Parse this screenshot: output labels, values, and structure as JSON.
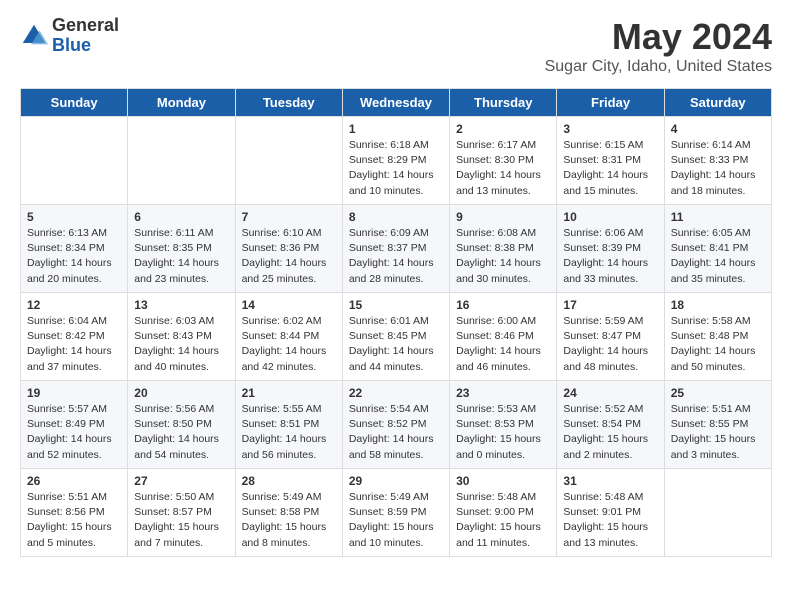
{
  "logo": {
    "general": "General",
    "blue": "Blue"
  },
  "title": "May 2024",
  "subtitle": "Sugar City, Idaho, United States",
  "days_of_week": [
    "Sunday",
    "Monday",
    "Tuesday",
    "Wednesday",
    "Thursday",
    "Friday",
    "Saturday"
  ],
  "weeks": [
    [
      {
        "day": "",
        "info": ""
      },
      {
        "day": "",
        "info": ""
      },
      {
        "day": "",
        "info": ""
      },
      {
        "day": "1",
        "info": "Sunrise: 6:18 AM\nSunset: 8:29 PM\nDaylight: 14 hours\nand 10 minutes."
      },
      {
        "day": "2",
        "info": "Sunrise: 6:17 AM\nSunset: 8:30 PM\nDaylight: 14 hours\nand 13 minutes."
      },
      {
        "day": "3",
        "info": "Sunrise: 6:15 AM\nSunset: 8:31 PM\nDaylight: 14 hours\nand 15 minutes."
      },
      {
        "day": "4",
        "info": "Sunrise: 6:14 AM\nSunset: 8:33 PM\nDaylight: 14 hours\nand 18 minutes."
      }
    ],
    [
      {
        "day": "5",
        "info": "Sunrise: 6:13 AM\nSunset: 8:34 PM\nDaylight: 14 hours\nand 20 minutes."
      },
      {
        "day": "6",
        "info": "Sunrise: 6:11 AM\nSunset: 8:35 PM\nDaylight: 14 hours\nand 23 minutes."
      },
      {
        "day": "7",
        "info": "Sunrise: 6:10 AM\nSunset: 8:36 PM\nDaylight: 14 hours\nand 25 minutes."
      },
      {
        "day": "8",
        "info": "Sunrise: 6:09 AM\nSunset: 8:37 PM\nDaylight: 14 hours\nand 28 minutes."
      },
      {
        "day": "9",
        "info": "Sunrise: 6:08 AM\nSunset: 8:38 PM\nDaylight: 14 hours\nand 30 minutes."
      },
      {
        "day": "10",
        "info": "Sunrise: 6:06 AM\nSunset: 8:39 PM\nDaylight: 14 hours\nand 33 minutes."
      },
      {
        "day": "11",
        "info": "Sunrise: 6:05 AM\nSunset: 8:41 PM\nDaylight: 14 hours\nand 35 minutes."
      }
    ],
    [
      {
        "day": "12",
        "info": "Sunrise: 6:04 AM\nSunset: 8:42 PM\nDaylight: 14 hours\nand 37 minutes."
      },
      {
        "day": "13",
        "info": "Sunrise: 6:03 AM\nSunset: 8:43 PM\nDaylight: 14 hours\nand 40 minutes."
      },
      {
        "day": "14",
        "info": "Sunrise: 6:02 AM\nSunset: 8:44 PM\nDaylight: 14 hours\nand 42 minutes."
      },
      {
        "day": "15",
        "info": "Sunrise: 6:01 AM\nSunset: 8:45 PM\nDaylight: 14 hours\nand 44 minutes."
      },
      {
        "day": "16",
        "info": "Sunrise: 6:00 AM\nSunset: 8:46 PM\nDaylight: 14 hours\nand 46 minutes."
      },
      {
        "day": "17",
        "info": "Sunrise: 5:59 AM\nSunset: 8:47 PM\nDaylight: 14 hours\nand 48 minutes."
      },
      {
        "day": "18",
        "info": "Sunrise: 5:58 AM\nSunset: 8:48 PM\nDaylight: 14 hours\nand 50 minutes."
      }
    ],
    [
      {
        "day": "19",
        "info": "Sunrise: 5:57 AM\nSunset: 8:49 PM\nDaylight: 14 hours\nand 52 minutes."
      },
      {
        "day": "20",
        "info": "Sunrise: 5:56 AM\nSunset: 8:50 PM\nDaylight: 14 hours\nand 54 minutes."
      },
      {
        "day": "21",
        "info": "Sunrise: 5:55 AM\nSunset: 8:51 PM\nDaylight: 14 hours\nand 56 minutes."
      },
      {
        "day": "22",
        "info": "Sunrise: 5:54 AM\nSunset: 8:52 PM\nDaylight: 14 hours\nand 58 minutes."
      },
      {
        "day": "23",
        "info": "Sunrise: 5:53 AM\nSunset: 8:53 PM\nDaylight: 15 hours\nand 0 minutes."
      },
      {
        "day": "24",
        "info": "Sunrise: 5:52 AM\nSunset: 8:54 PM\nDaylight: 15 hours\nand 2 minutes."
      },
      {
        "day": "25",
        "info": "Sunrise: 5:51 AM\nSunset: 8:55 PM\nDaylight: 15 hours\nand 3 minutes."
      }
    ],
    [
      {
        "day": "26",
        "info": "Sunrise: 5:51 AM\nSunset: 8:56 PM\nDaylight: 15 hours\nand 5 minutes."
      },
      {
        "day": "27",
        "info": "Sunrise: 5:50 AM\nSunset: 8:57 PM\nDaylight: 15 hours\nand 7 minutes."
      },
      {
        "day": "28",
        "info": "Sunrise: 5:49 AM\nSunset: 8:58 PM\nDaylight: 15 hours\nand 8 minutes."
      },
      {
        "day": "29",
        "info": "Sunrise: 5:49 AM\nSunset: 8:59 PM\nDaylight: 15 hours\nand 10 minutes."
      },
      {
        "day": "30",
        "info": "Sunrise: 5:48 AM\nSunset: 9:00 PM\nDaylight: 15 hours\nand 11 minutes."
      },
      {
        "day": "31",
        "info": "Sunrise: 5:48 AM\nSunset: 9:01 PM\nDaylight: 15 hours\nand 13 minutes."
      },
      {
        "day": "",
        "info": ""
      }
    ]
  ]
}
